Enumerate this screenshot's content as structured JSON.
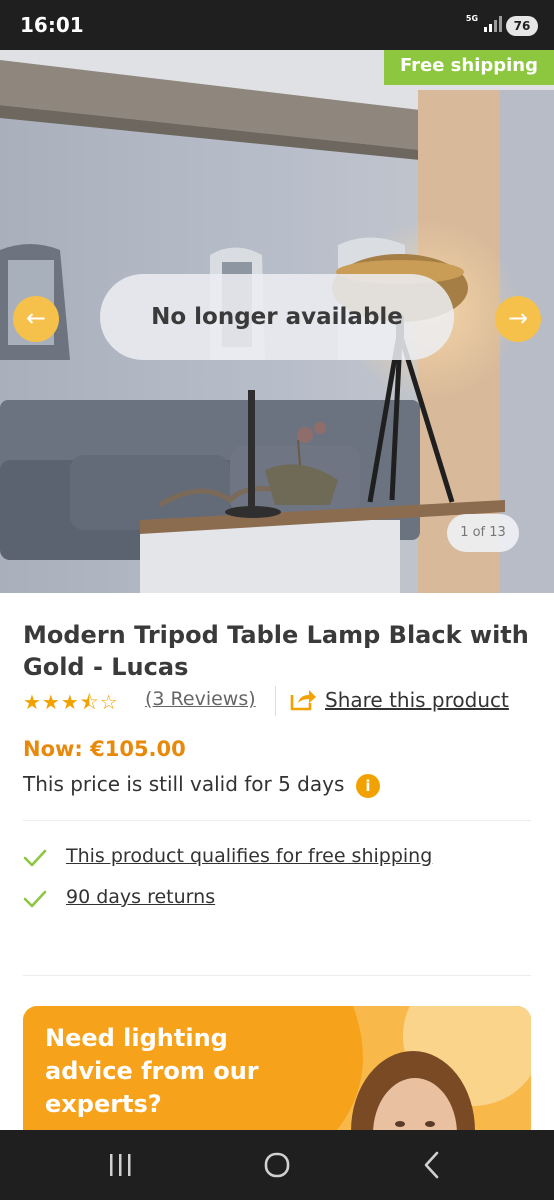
{
  "status_bar": {
    "time": "16:01",
    "network": "5G",
    "battery": "76"
  },
  "gallery": {
    "badge": "Free shipping",
    "status_overlay": "No longer available",
    "prev_arrow": "←",
    "next_arrow": "→",
    "counter": "1 of 13"
  },
  "product": {
    "title": "Modern Tripod Table Lamp Black with Gold - Lucas",
    "rating": 3.5,
    "rating_max": 5,
    "stars": "★★★⯪☆",
    "reviews_link": "(3 Reviews)",
    "share_link": "Share this product",
    "price": "Now: €105.00",
    "price_validity": "This price is still valid for 5 days",
    "info_icon": "i"
  },
  "usps": [
    {
      "label": "This product qualifies for free shipping",
      "icon": "check-icon"
    },
    {
      "label": "90 days returns",
      "icon": "check-icon"
    }
  ],
  "advice_banner": {
    "heading": "Need lighting advice from our experts?"
  },
  "colors": {
    "accent_orange": "#f1a200",
    "badge_green": "#8dc63f",
    "price_orange": "#e8890c",
    "check_green": "#8dc63f",
    "banner_orange": "#f7a21b"
  },
  "icons": {
    "share": "share-icon",
    "recent_apps": "recent-apps-icon",
    "home": "home-icon",
    "back": "back-icon"
  }
}
